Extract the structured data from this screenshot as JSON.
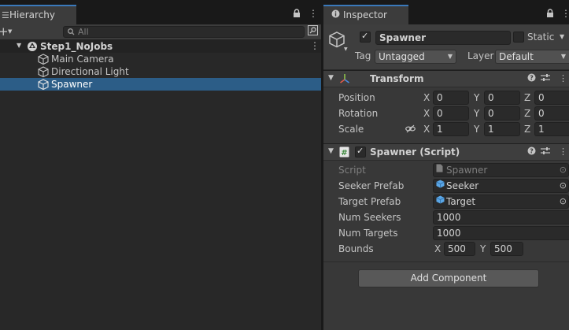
{
  "hierarchy": {
    "tab_label": "Hierarchy",
    "search_placeholder": "All",
    "scene_name": "Step1_NoJobs",
    "items": [
      {
        "label": "Main Camera"
      },
      {
        "label": "Directional Light"
      },
      {
        "label": "Spawner",
        "selected": true
      }
    ]
  },
  "inspector": {
    "tab_label": "Inspector",
    "object_name": "Spawner",
    "active": true,
    "static_label": "Static",
    "static_checked": false,
    "tag_label": "Tag",
    "tag_value": "Untagged",
    "layer_label": "Layer",
    "layer_value": "Default",
    "transform": {
      "title": "Transform",
      "rows": [
        {
          "label": "Position",
          "x": "0",
          "y": "0",
          "z": "0"
        },
        {
          "label": "Rotation",
          "x": "0",
          "y": "0",
          "z": "0"
        },
        {
          "label": "Scale",
          "x": "1",
          "y": "1",
          "z": "1"
        }
      ],
      "axis_x": "X",
      "axis_y": "Y",
      "axis_z": "Z"
    },
    "script_component": {
      "title": "Spawner (Script)",
      "enabled": true,
      "script_label": "Script",
      "script_value": "Spawner",
      "seeker_prefab_label": "Seeker Prefab",
      "seeker_prefab_value": "Seeker",
      "target_prefab_label": "Target Prefab",
      "target_prefab_value": "Target",
      "num_seekers_label": "Num Seekers",
      "num_seekers_value": "1000",
      "num_targets_label": "Num Targets",
      "num_targets_value": "1000",
      "bounds_label": "Bounds",
      "bounds_x": "500",
      "bounds_y": "500"
    },
    "add_component_label": "Add Component"
  },
  "colors": {
    "selection": "#2c5d87",
    "tab_accent": "#3a79bb",
    "prefab_icon": "#5aa6e6"
  }
}
